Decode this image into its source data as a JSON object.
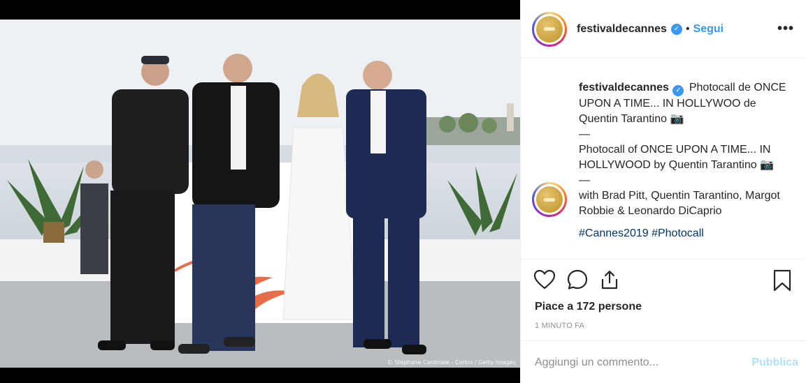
{
  "post": {
    "photo_credit": "© Stephane Cardinale - Corbis / Getty Images"
  },
  "header": {
    "username": "festivaldecannes",
    "verified_icon": "verified-badge-icon",
    "separator": "•",
    "follow_label": "Segui",
    "more_label": "•••"
  },
  "caption": {
    "username": "festivaldecannes",
    "line_it_1": "Photocall de ONCE UPON A TIME... IN HOLLYWOO de Quentin Tarantino 📷",
    "dash_1": "—",
    "line_en": "Photocall of ONCE UPON A TIME... IN HOLLYWOOD by Quentin Tarantino 📷",
    "dash_2": "—",
    "with_line": "with Brad Pitt, Quentin Tarantino, Margot Robbie & Leonardo DiCaprio",
    "hashtags": "#Cannes2019 #Photocall"
  },
  "actions": {
    "like_icon": "heart-icon",
    "comment_icon": "comment-bubble-icon",
    "share_icon": "share-icon",
    "save_icon": "bookmark-icon",
    "likes_text": "Piace a 172 persone",
    "timestamp": "1 MINUTO FA"
  },
  "comment_box": {
    "placeholder": "Aggiungi un commento...",
    "publish_label": "Pubblica"
  },
  "colors": {
    "accent": "#3897f0",
    "publish_disabled": "#b2dffc",
    "text": "#262626",
    "muted": "#8e8e8e"
  }
}
